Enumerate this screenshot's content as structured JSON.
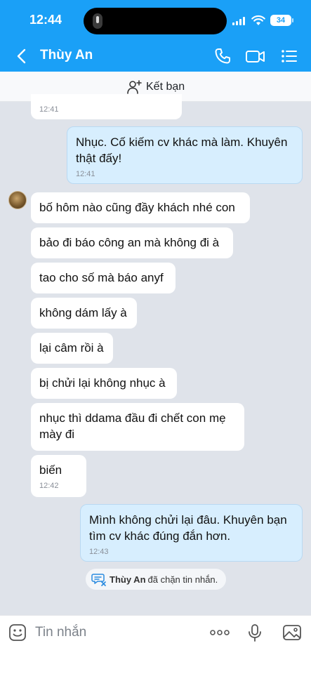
{
  "status_bar": {
    "time": "12:44",
    "battery": "34"
  },
  "header": {
    "contact_name": "Thùy An"
  },
  "add_friend": {
    "label": "Kết bạn"
  },
  "messages": [
    {
      "side": "in",
      "text": "",
      "time": "12:41"
    },
    {
      "side": "out",
      "text": "Nhục. Cố kiếm cv khác mà làm. Khuyên thật đấy!",
      "time": "12:41"
    },
    {
      "side": "in",
      "text": "bố hôm nào cũng đầy khách nhé con"
    },
    {
      "side": "in",
      "text": "bảo đi báo công an mà không đi à"
    },
    {
      "side": "in",
      "text": "tao cho số mà báo anyf"
    },
    {
      "side": "in",
      "text": "không dám lấy à"
    },
    {
      "side": "in",
      "text": "lại câm rồi à"
    },
    {
      "side": "in",
      "text": "bị chửi lại không nhục à"
    },
    {
      "side": "in",
      "text": "nhục thì ddama đầu đi chết con mẹ mày đi"
    },
    {
      "side": "in",
      "text": "biến",
      "time": "12:42"
    },
    {
      "side": "out",
      "text": "Mình không chửi lại đâu. Khuyên bạn tìm cv khác đúng đắn hơn.",
      "time": "12:43"
    }
  ],
  "block_notice": {
    "name": "Thùy An",
    "text": "đã chặn tin nhắn."
  },
  "input": {
    "placeholder": "Tin nhắn"
  },
  "icons": {
    "back": "chevron-left-icon",
    "call": "phone-icon",
    "video": "video-camera-icon",
    "menu": "list-menu-icon",
    "add_friend": "add-user-icon",
    "emoji": "emoji-icon",
    "more": "more-dots-icon",
    "mic": "microphone-icon",
    "image": "image-icon",
    "blocked": "blocked-chat-icon"
  },
  "colors": {
    "header": "#1aa0f7",
    "background": "#dfe3ea",
    "outgoing_bubble": "#d7eefe",
    "incoming_bubble": "#ffffff"
  }
}
